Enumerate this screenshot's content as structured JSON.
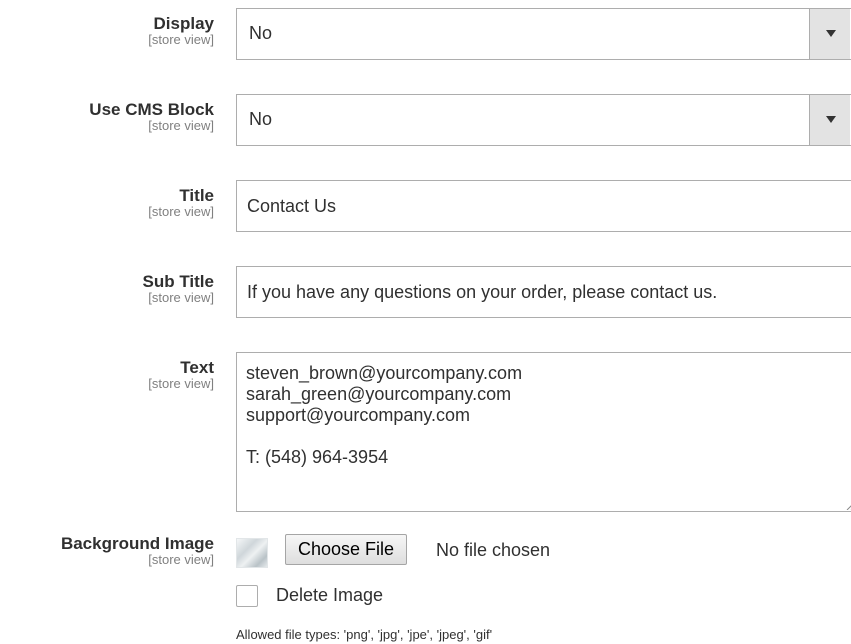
{
  "fields": {
    "display": {
      "label": "Display",
      "scope": "[store view]",
      "value": "No"
    },
    "use_cms_block": {
      "label": "Use CMS Block",
      "scope": "[store view]",
      "value": "No"
    },
    "title": {
      "label": "Title",
      "scope": "[store view]",
      "value": "Contact Us"
    },
    "sub_title": {
      "label": "Sub Title",
      "scope": "[store view]",
      "value": "If you have any questions on your order, please contact us."
    },
    "text": {
      "label": "Text",
      "scope": "[store view]",
      "value": "steven_brown@yourcompany.com\nsarah_green@yourcompany.com\nsupport@yourcompany.com\n\nT: (548) 964-3954"
    },
    "background_image": {
      "label": "Background Image",
      "scope": "[store view]",
      "choose_file_label": "Choose File",
      "file_status": "No file chosen",
      "delete_label": "Delete Image",
      "allowed_note": "Allowed file types: 'png', 'jpg', 'jpe', 'jpeg', 'gif'"
    }
  },
  "icons": {
    "select_arrow": "triangle-down-icon",
    "image_thumbnail": "image-thumbnail-icon",
    "resize": "resize-handle-icon"
  },
  "colors": {
    "label_text": "#303030",
    "scope_text": "#808080",
    "border": "#adadad",
    "select_arrow_bg": "#e3e3e3"
  }
}
